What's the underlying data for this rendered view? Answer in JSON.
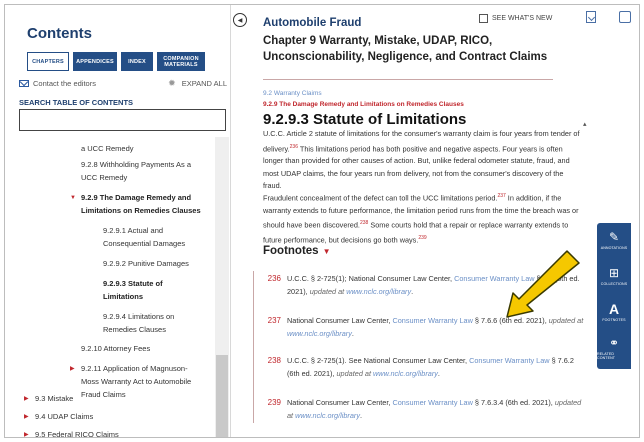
{
  "sidebar": {
    "title": "Contents",
    "tabs": [
      {
        "label": "CHAPTERS"
      },
      {
        "label": "APPENDICES"
      },
      {
        "label": "INDEX"
      },
      {
        "label": "COMPANION MATERIALS"
      }
    ],
    "contact_label": "Contact the editors",
    "expand_all_label": "EXPAND ALL",
    "search_label": "SEARCH TABLE OF CONTENTS",
    "search_value": "",
    "toc": [
      {
        "label": "a UCC Remedy"
      },
      {
        "label": "9.2.8 Withholding Payments As a"
      },
      {
        "label": "UCC Remedy"
      },
      {
        "label": "9.2.9 The Damage Remedy and"
      },
      {
        "label": "Limitations on Remedies Clauses"
      },
      {
        "label": "9.2.9.1 Actual and"
      },
      {
        "label": "Consequential Damages"
      },
      {
        "label": "9.2.9.2 Punitive Damages"
      },
      {
        "label": "9.2.9.3 Statute of"
      },
      {
        "label": "Limitations"
      },
      {
        "label": "9.2.9.4 Limitations on"
      },
      {
        "label": "Remedies Clauses"
      },
      {
        "label": "9.2.10 Attorney Fees"
      },
      {
        "label": "9.2.11 Application of Magnuson-"
      },
      {
        "label": "Moss Warranty Act to Automobile"
      },
      {
        "label": "Fraud Claims"
      },
      {
        "label": "9.3 Mistake"
      },
      {
        "label": "9.4 UDAP Claims"
      },
      {
        "label": "9.5 Federal RICO Claims"
      }
    ]
  },
  "main": {
    "whats_new_label": "SEE WHAT'S NEW",
    "book_title": "Automobile Fraud",
    "chapter_title": "Chapter 9 Warranty, Mistake, UDAP, RICO, Unconscionability, Negligence, and Contract Claims",
    "breadcrumb": "9.2 Warranty Claims",
    "sub_heading": "9.2.9 The Damage Remedy and Limitations on Remedies Clauses",
    "section_title": "9.2.9.3 Statute of Limitations",
    "para1": {
      "a": "U.C.C. Article 2 statute of limitations for the consumer's warranty claim is four years from tender of delivery.",
      "ref1": "236",
      "b": " This limitations period has both positive and negative aspects. Four years is often longer than provided for other causes of action. But, unlike federal odometer statute, fraud, and most UDAP claims, the four years run from delivery, not from the consumer's discovery of the fraud."
    },
    "para2": {
      "a": "Fraudulent concealment of the defect can toll the UCC limitations period.",
      "ref1": "237",
      "b": " In addition, if the warranty extends to future performance, the limitation period runs from the time the breach was or should have been discovered.",
      "ref2": "238",
      "c": " Some courts hold that a repair or replace warranty extends to future performance, but decisions go both ways.",
      "ref3": "239"
    },
    "footnotes_title": "Footnotes",
    "footnotes": [
      {
        "num": "236",
        "pre": "U.C.C. § 2-725(1); National Consumer Law Center, ",
        "link": "Consumer Warranty Law",
        "post": " § 7.6 (6th ed. 2021), ",
        "updated": "updated at",
        "url": "www.nclc.org/library",
        "end": "."
      },
      {
        "num": "237",
        "pre": "National Consumer Law Center, ",
        "link": "Consumer Warranty Law",
        "post": " § 7.6.6 (6th ed. 2021), ",
        "updated": "updated at",
        "url": "www.nclc.org/library",
        "end": "."
      },
      {
        "num": "238",
        "pre": "U.C.C. § 2-725(1). See National Consumer Law Center, ",
        "link": "Consumer Warranty Law",
        "post": " § 7.6.2 (6th ed. 2021), ",
        "updated": "updated at",
        "url": "www.nclc.org/library",
        "end": "."
      },
      {
        "num": "239",
        "pre": "National Consumer Law Center, ",
        "link": "Consumer Warranty Law",
        "post": " § 7.6.3.4 (6th ed. 2021), ",
        "updated": "updated at",
        "url": "www.nclc.org/library",
        "end": "."
      }
    ]
  },
  "toolbar": {
    "items": [
      {
        "label": "ANNOTATIONS",
        "icon": "pencil-icon"
      },
      {
        "label": "COLLECTIONS",
        "icon": "grid-icon"
      },
      {
        "label": "FOOTNOTES",
        "icon": "a-icon"
      },
      {
        "label": "RELATED CONTENT",
        "icon": "link-icon"
      }
    ]
  },
  "colors": {
    "brand": "#244e86",
    "accent": "#c0272d",
    "link": "#6a8fc6",
    "arrow": "#f5c800"
  }
}
